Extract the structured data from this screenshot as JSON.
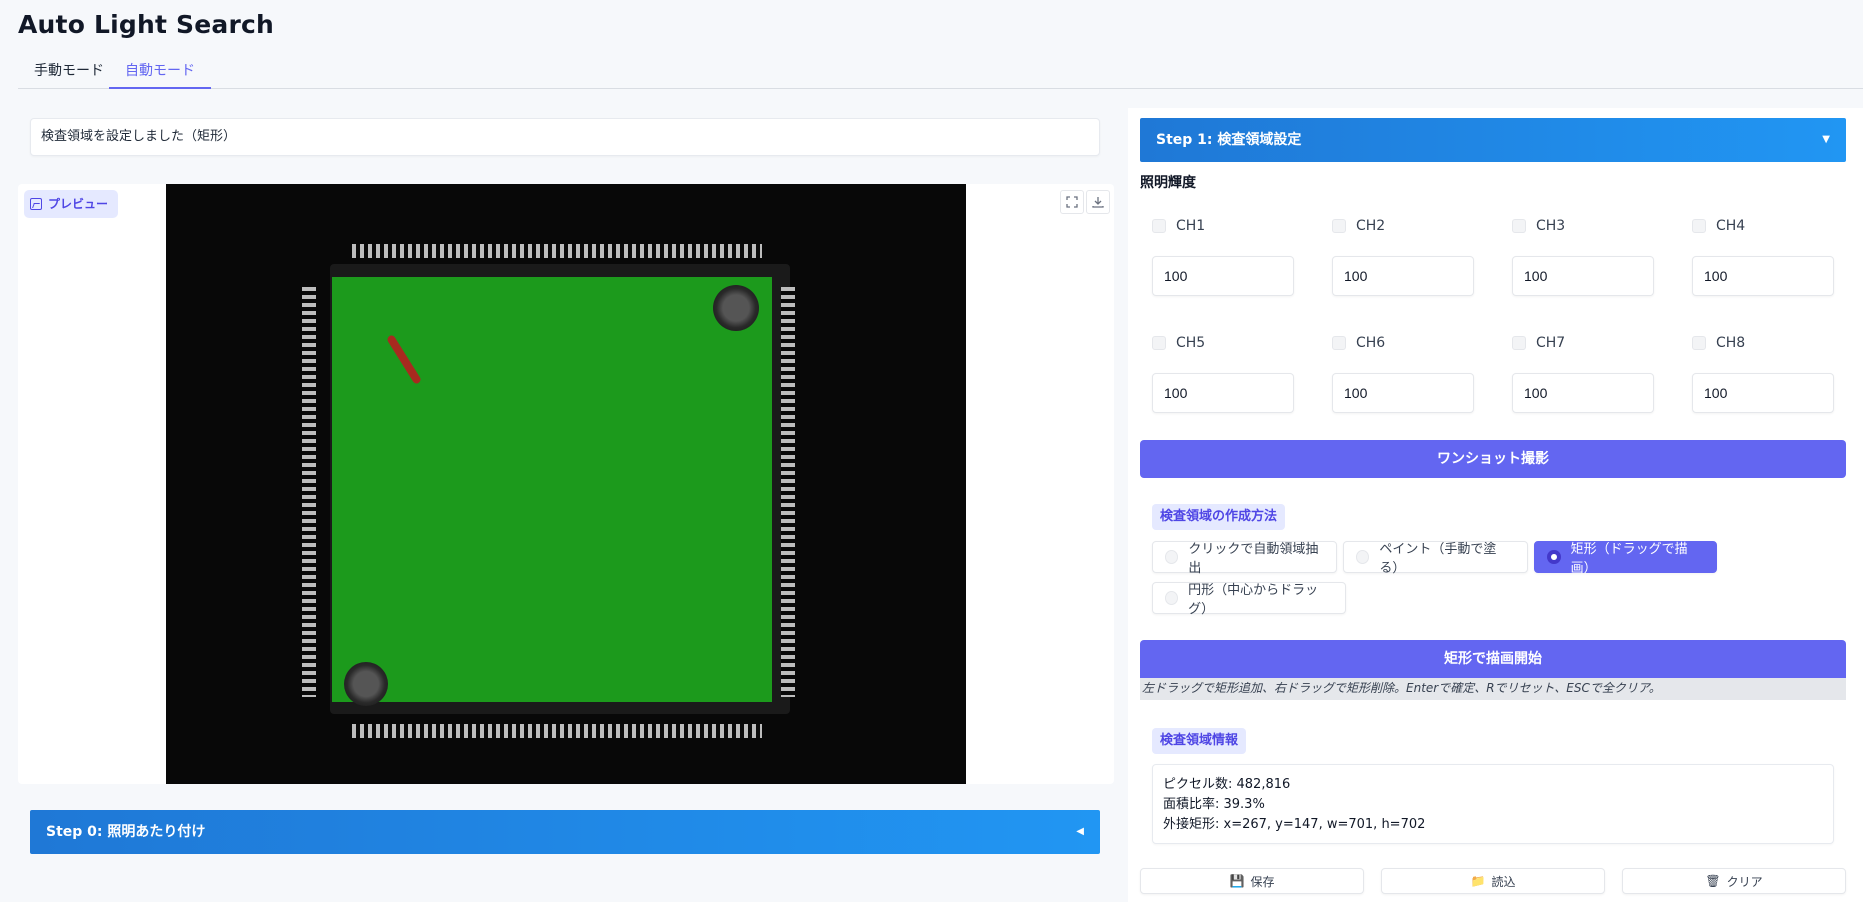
{
  "app": {
    "title": "Auto Light Search"
  },
  "tabs": [
    {
      "label": "手動モード",
      "active": false
    },
    {
      "label": "自動モード",
      "active": true
    }
  ],
  "left": {
    "status_message": "検査領域を設定しました（矩形）",
    "preview_label": "プレビュー",
    "step0_label": "Step 0: 照明あたり付け"
  },
  "right": {
    "step1_label": "Step 1: 検査領域設定",
    "brightness_label": "照明輝度",
    "channels": [
      {
        "name": "CH1",
        "value": "100"
      },
      {
        "name": "CH2",
        "value": "100"
      },
      {
        "name": "CH3",
        "value": "100"
      },
      {
        "name": "CH4",
        "value": "100"
      },
      {
        "name": "CH5",
        "value": "100"
      },
      {
        "name": "CH6",
        "value": "100"
      },
      {
        "name": "CH7",
        "value": "100"
      },
      {
        "name": "CH8",
        "value": "100"
      }
    ],
    "oneshot_label": "ワンショット撮影",
    "method_label": "検査領域の作成方法",
    "methods": [
      {
        "label": "クリックで自動領域抽出",
        "selected": false
      },
      {
        "label": "ペイント（手動で塗る）",
        "selected": false
      },
      {
        "label": "矩形（ドラッグで描画）",
        "selected": true
      },
      {
        "label": "円形（中心からドラッグ）",
        "selected": false
      }
    ],
    "draw_button_label": "矩形で描画開始",
    "hint": "左ドラッグで矩形追加、右ドラッグで矩形削除。Enterで確定、Rでリセット、ESCで全クリア。",
    "info_label": "検査領域情報",
    "info": {
      "pixels": "ピクセル数: 482,816",
      "area_ratio": "面積比率: 39.3%",
      "bbox": "外接矩形: x=267, y=147, w=701, h=702"
    },
    "buttons": {
      "save": "保存",
      "load": "読込",
      "clear": "クリア"
    }
  },
  "colors": {
    "accent": "#6366f1",
    "step_header": "#2196f3",
    "region_green": "#1c9a1c"
  }
}
